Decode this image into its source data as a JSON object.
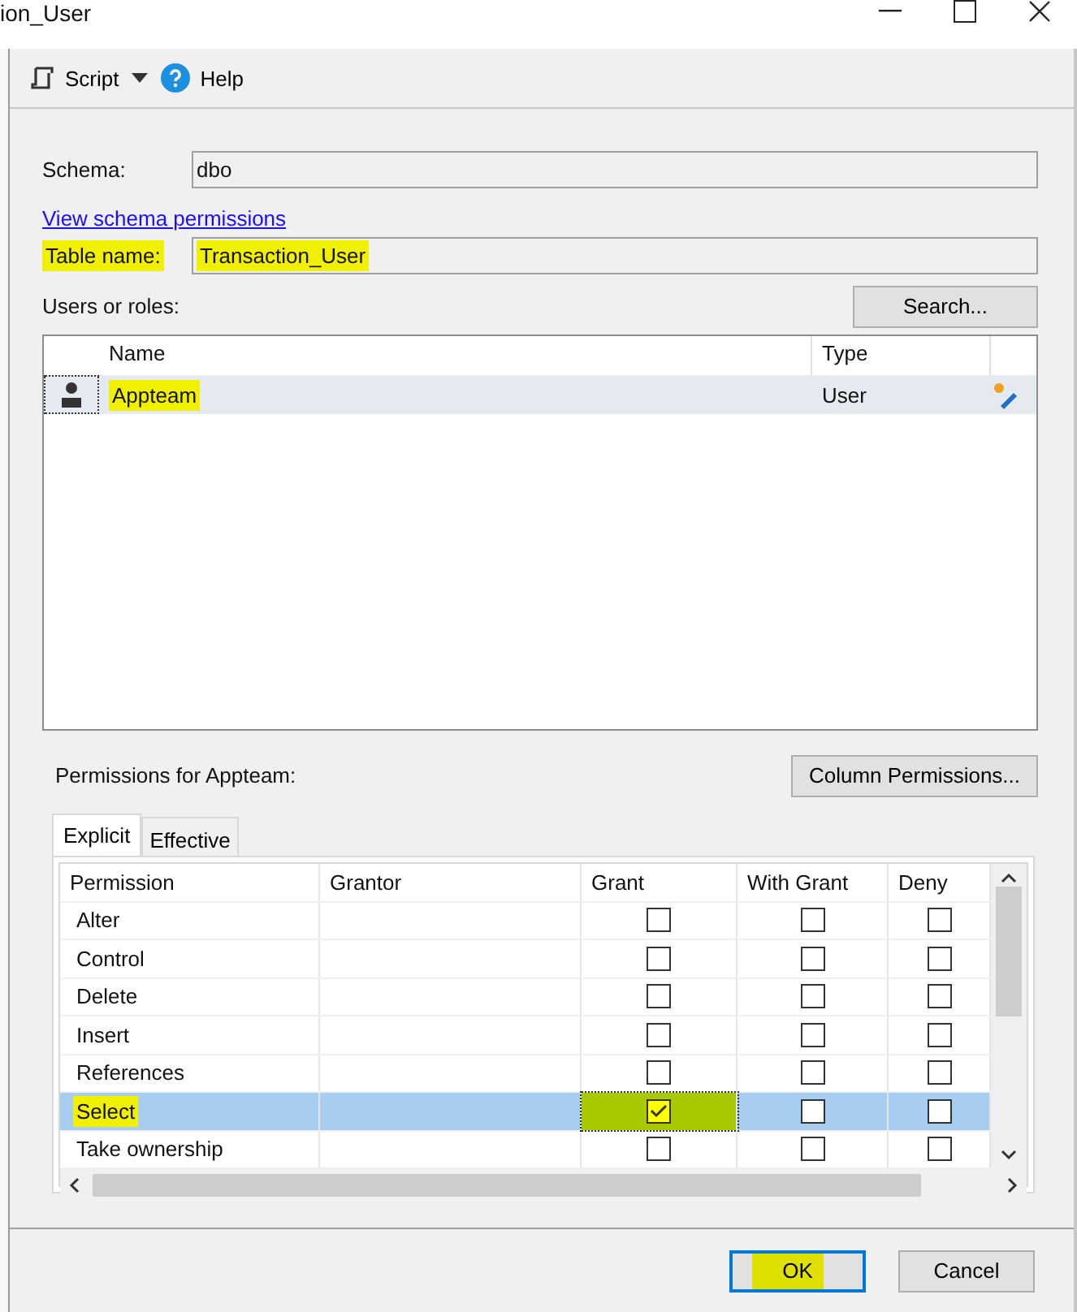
{
  "window": {
    "title": "ion_User"
  },
  "toolbar": [
    {
      "kind": "script",
      "label": "Script"
    },
    {
      "kind": "help",
      "label": "Help"
    }
  ],
  "schema": {
    "label": "Schema:",
    "value": "dbo"
  },
  "schema_link": "View schema permissions",
  "table_name": {
    "label": "Table name:",
    "value": "Transaction_User",
    "highlighted": true
  },
  "users": {
    "label": "Users or roles:",
    "search_button": "Search...",
    "columns": [
      "Name",
      "Type"
    ],
    "rows": [
      {
        "name": "Appteam",
        "type": "User",
        "selected": true,
        "highlighted": true
      }
    ]
  },
  "permissions": {
    "label": "Permissions for Appteam:",
    "column_button": "Column Permissions...",
    "tabs": [
      {
        "label": "Explicit",
        "selected": true
      },
      {
        "label": "Effective",
        "selected": false
      }
    ],
    "columns": [
      "Permission",
      "Grantor",
      "Grant",
      "With Grant",
      "Deny"
    ],
    "rows": [
      {
        "name": "Alter",
        "grant": false,
        "with_grant": false,
        "deny": false,
        "selected": false,
        "highlighted": false
      },
      {
        "name": "Control",
        "grant": false,
        "with_grant": false,
        "deny": false,
        "selected": false,
        "highlighted": false
      },
      {
        "name": "Delete",
        "grant": false,
        "with_grant": false,
        "deny": false,
        "selected": false,
        "highlighted": false
      },
      {
        "name": "Insert",
        "grant": false,
        "with_grant": false,
        "deny": false,
        "selected": false,
        "highlighted": false
      },
      {
        "name": "References",
        "grant": false,
        "with_grant": false,
        "deny": false,
        "selected": false,
        "highlighted": false
      },
      {
        "name": "Select",
        "grant": true,
        "with_grant": false,
        "deny": false,
        "selected": true,
        "highlighted": true
      },
      {
        "name": "Take ownership",
        "grant": false,
        "with_grant": false,
        "deny": false,
        "selected": false,
        "highlighted": false
      }
    ]
  },
  "buttons": [
    {
      "label": "OK",
      "default": true,
      "highlighted": true
    },
    {
      "label": "Cancel",
      "default": false,
      "highlighted": false
    }
  ]
}
